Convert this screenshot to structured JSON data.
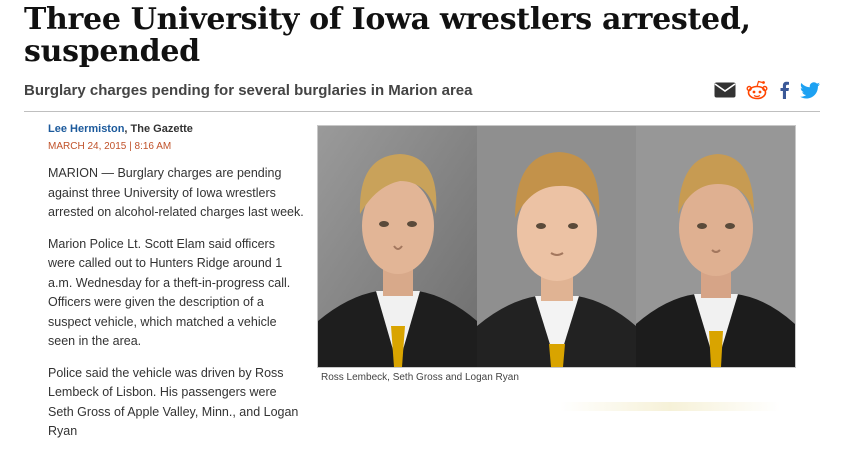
{
  "article": {
    "headline": "Three University of Iowa wrestlers arrested, suspended",
    "subheadline": "Burglary charges pending for several burglaries in Marion area",
    "author": "Lee Hermiston",
    "outlet": ", The Gazette",
    "date": "MARCH 24, 2015 | 8:16 AM",
    "paragraphs": [
      "MARION — Burglary charges are pending against three University of Iowa wrestlers arrested on alcohol-related charges last week.",
      "Marion Police Lt. Scott Elam said officers were called out to Hunters Ridge around 1 a.m. Wednesday for a theft-in-progress call. Officers were given the description of a suspect vehicle, which matched a vehicle seen in the area.",
      "Police said the vehicle was driven by Ross Lembeck of Lisbon. His passengers were Seth Gross of Apple Valley, Minn., and Logan Ryan"
    ],
    "photo_caption": "Ross Lembeck, Seth Gross and Logan Ryan"
  },
  "share_icons": [
    "email-icon",
    "reddit-icon",
    "facebook-icon",
    "twitter-icon"
  ],
  "colors": {
    "link": "#1c5a9c",
    "date": "#c0522a",
    "facebook": "#3b5998",
    "twitter": "#1da1f2",
    "reddit": "#ff4500",
    "tie": "#d9a400"
  }
}
